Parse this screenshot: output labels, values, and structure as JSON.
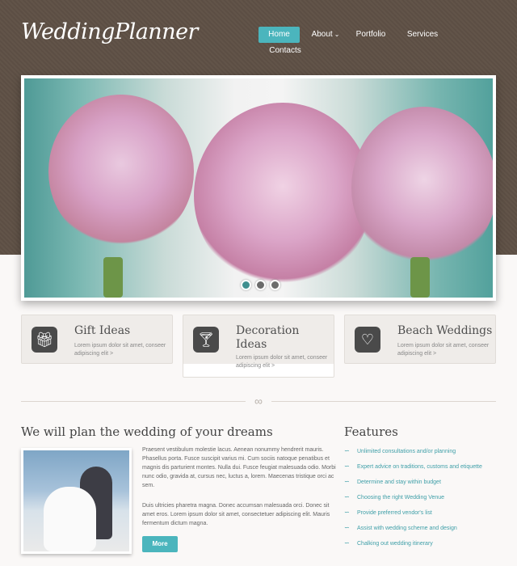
{
  "logo": "WeddingPlanner",
  "nav": {
    "home": "Home",
    "about": "About",
    "portfolio": "Portfolio",
    "services": "Services",
    "contacts": "Contacts"
  },
  "slider": {
    "active_dot": 1,
    "dot_count": 3
  },
  "feature_boxes": [
    {
      "title": "Gift Ideas",
      "desc": "Lorem ipsum dolor sit amet, conseer adipiscing elit >",
      "icon": "gift-icon"
    },
    {
      "title": "Decoration Ideas",
      "desc": "Lorem ipsum dolor sit amet, conseer adipiscing elit >",
      "icon": "cocktail-glass-icon"
    },
    {
      "title": "Beach Weddings",
      "desc": "Lorem ipsum dolor sit amet, conseer adipiscing elit >",
      "icon": "hearts-icon"
    }
  ],
  "main": {
    "title": "We will plan the wedding of your dreams",
    "paragraph1": "Praesent vestibulum molestie lacus. Aenean nonummy hendrerit mauris. Phasellus porta. Fusce suscipit varius mi. Cum sociis natoque penatibus et magnis dis parturient montes. Nulla dui. Fusce feugiat malesuada odio. Morbi nunc odio, gravida at, cursus nec, luctus a, lorem. Maecenas tristique orci ac sem.",
    "paragraph2": "Duis ultricies pharetra magna. Donec accumsan malesuada orci. Donec sit amet eros. Lorem ipsum dolor sit amet, consectetuer adipiscing elit. Mauris fermentum dictum magna.",
    "more_label": "More"
  },
  "features": {
    "title": "Features",
    "items": [
      "Unlimited consultations and/or planning",
      "Expert advice on traditions, customs and etiquette",
      "Determine and stay within budget",
      "Choosing the right Wedding Venue",
      "Provide preferred vendor's list",
      "Assist with wedding scheme and design",
      "Chalking out wedding itinerary"
    ]
  },
  "colors": {
    "accent": "#4bb5bd",
    "header_bg": "#5e5045"
  }
}
